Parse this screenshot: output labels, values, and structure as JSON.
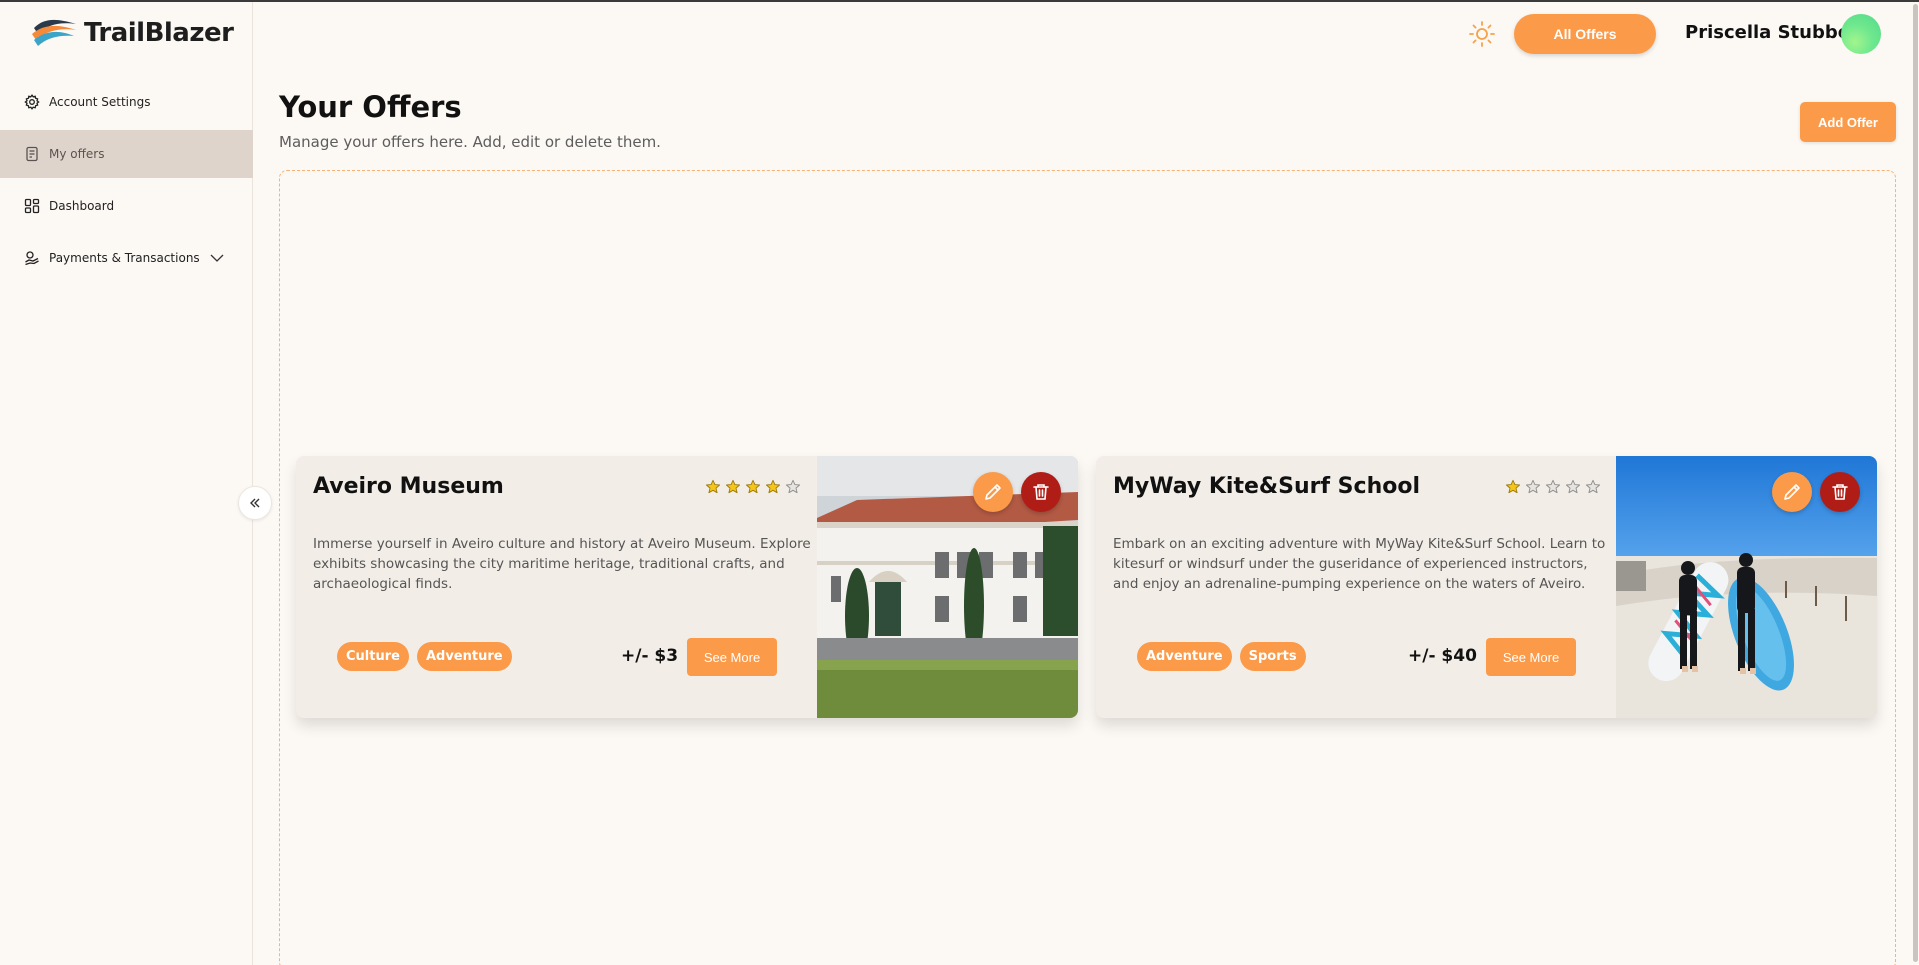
{
  "app": {
    "name": "TrailBlazer"
  },
  "sidebar": {
    "items": [
      {
        "label": "Account Settings",
        "icon": "gear-icon",
        "active": false
      },
      {
        "label": "My offers",
        "icon": "document-icon",
        "active": true
      },
      {
        "label": "Dashboard",
        "icon": "grid-icon",
        "active": false
      },
      {
        "label": "Payments & Transactions",
        "icon": "money-icon",
        "active": false,
        "expandable": true
      }
    ]
  },
  "header": {
    "theme_icon": "sun-icon",
    "all_offers_label": "All Offers",
    "user_name": "Priscella Stubbert"
  },
  "main": {
    "title": "Your Offers",
    "subtitle": "Manage your offers here. Add, edit or delete them.",
    "add_offer_label": "Add Offer"
  },
  "offers": [
    {
      "title": "Aveiro Museum",
      "rating": 4,
      "rating_max": 5,
      "description": "Immerse yourself in Aveiro culture and history at Aveiro Museum. Explore exhibits showcasing the city maritime heritage, traditional crafts, and archaeological finds.",
      "tags": [
        "Culture",
        "Adventure"
      ],
      "price": "+/- $3",
      "see_more_label": "See More",
      "image_alt": "Aveiro Museum building"
    },
    {
      "title": "MyWay Kite&Surf School",
      "rating": 1,
      "rating_max": 5,
      "description": "Embark on an exciting adventure with MyWay Kite&Surf School. Learn to kitesurf or windsurf under the guseridance of experienced instructors, and enjoy an adrenaline-pumping experience on the waters of Aveiro.",
      "tags": [
        "Adventure",
        "Sports"
      ],
      "price": "+/- $40",
      "see_more_label": "See More",
      "image_alt": "Surfers on the beach"
    }
  ],
  "colors": {
    "accent": "#fb9a48",
    "danger": "#b01d17",
    "background": "#fcf8f4",
    "card": "#f2ede7",
    "star_filled": "#f5c518"
  }
}
